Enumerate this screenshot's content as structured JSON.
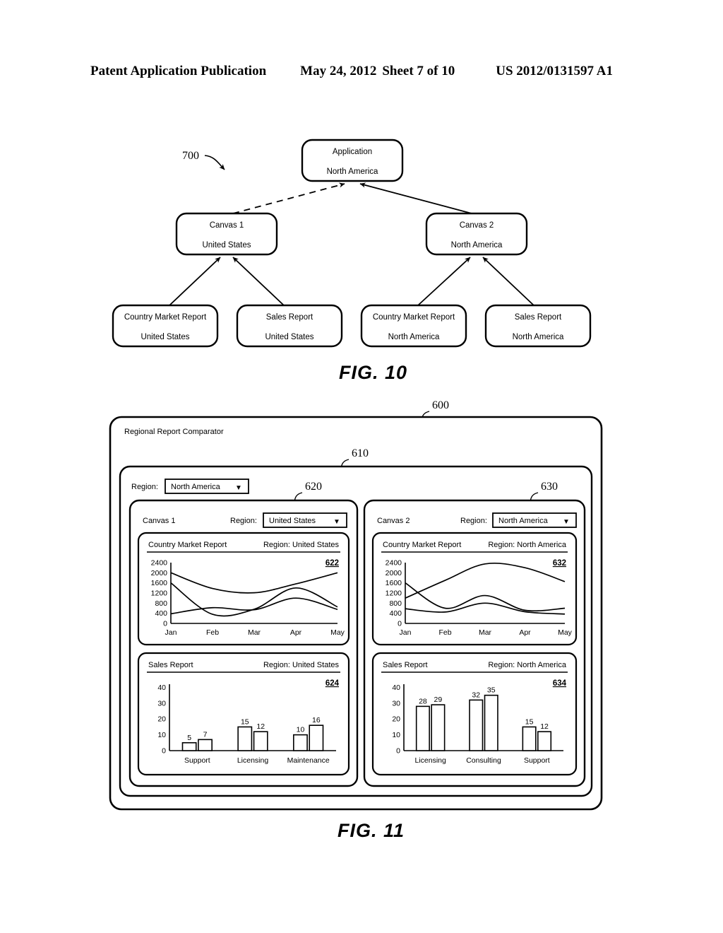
{
  "header": {
    "publication": "Patent Application Publication",
    "date": "May 24, 2012",
    "sheet": "Sheet 7 of 10",
    "patent_number": "US 2012/0131597 A1"
  },
  "fig10": {
    "caption": "FIG.  10",
    "ref_label": "700",
    "nodes": {
      "application": {
        "title": "Application",
        "region": "North America"
      },
      "canvas1": {
        "title": "Canvas 1",
        "region": "United States"
      },
      "canvas2": {
        "title": "Canvas 2",
        "region": "North America"
      },
      "report1": {
        "title": "Country Market Report",
        "region": "United States"
      },
      "report2": {
        "title": "Sales Report",
        "region": "United States"
      },
      "report3": {
        "title": "Country Market Report",
        "region": "North America"
      },
      "report4": {
        "title": "Sales Report",
        "region": "North America"
      }
    }
  },
  "fig11": {
    "caption": "FIG.  11",
    "window_title": "Regional Report Comparator",
    "ref_outer": "600",
    "ref_panel": "610",
    "ref_canvas1": "620",
    "ref_canvas2": "630",
    "global_region": {
      "label": "Region:",
      "value": "North America",
      "caret": "▼"
    },
    "canvas1": {
      "title": "Canvas 1",
      "region_label": "Region:",
      "region_value": "United States",
      "caret": "▼"
    },
    "canvas2": {
      "title": "Canvas 2",
      "region_label": "Region:",
      "region_value": "North America",
      "caret": "▼"
    }
  },
  "chart_data": [
    {
      "id": "622",
      "type": "line",
      "title": "Country Market Report",
      "subtitle": "Region: United States",
      "xlabel": "",
      "ylabel": "",
      "categories": [
        "Jan",
        "Feb",
        "Mar",
        "Apr",
        "May"
      ],
      "yticks": [
        0,
        400,
        800,
        1200,
        1600,
        2000,
        2400
      ],
      "ylim": [
        0,
        2400
      ],
      "grid": false,
      "legend": "none",
      "series": [
        {
          "name": "series-a",
          "values": [
            2000,
            1380,
            1210,
            1560,
            2000
          ]
        },
        {
          "name": "series-b",
          "values": [
            1600,
            360,
            560,
            1400,
            650
          ]
        },
        {
          "name": "series-c",
          "values": [
            380,
            620,
            540,
            1000,
            550
          ]
        }
      ]
    },
    {
      "id": "624",
      "type": "bar",
      "title": "Sales Report",
      "subtitle": "Region: United States",
      "xlabel": "",
      "ylabel": "",
      "categories": [
        "Support",
        "Licensing",
        "Maintenance"
      ],
      "yticks": [
        0,
        10,
        20,
        30,
        40
      ],
      "ylim": [
        0,
        42
      ],
      "grid": false,
      "legend": "none",
      "series": [
        {
          "name": "bar-left",
          "values": [
            5,
            15,
            10
          ]
        },
        {
          "name": "bar-right",
          "values": [
            7,
            12,
            16
          ]
        }
      ]
    },
    {
      "id": "632",
      "type": "line",
      "title": "Country Market Report",
      "subtitle": "Region: North America",
      "xlabel": "",
      "ylabel": "",
      "categories": [
        "Jan",
        "Feb",
        "Mar",
        "Apr",
        "May"
      ],
      "yticks": [
        0,
        400,
        800,
        1200,
        1600,
        2000,
        2400
      ],
      "ylim": [
        0,
        2400
      ],
      "grid": false,
      "legend": "none",
      "series": [
        {
          "name": "series-a",
          "values": [
            1000,
            1700,
            2350,
            2200,
            1650
          ]
        },
        {
          "name": "series-b",
          "values": [
            1600,
            600,
            1100,
            520,
            600
          ]
        },
        {
          "name": "series-c",
          "values": [
            580,
            450,
            800,
            460,
            370
          ]
        }
      ]
    },
    {
      "id": "634",
      "type": "bar",
      "title": "Sales Report",
      "subtitle": "Region: North America",
      "xlabel": "",
      "ylabel": "",
      "categories": [
        "Licensing",
        "Consulting",
        "Support"
      ],
      "yticks": [
        0,
        10,
        20,
        30,
        40
      ],
      "ylim": [
        0,
        42
      ],
      "grid": false,
      "legend": "none",
      "series": [
        {
          "name": "bar-left",
          "values": [
            28,
            32,
            15
          ]
        },
        {
          "name": "bar-right",
          "values": [
            29,
            35,
            12
          ]
        }
      ]
    }
  ]
}
